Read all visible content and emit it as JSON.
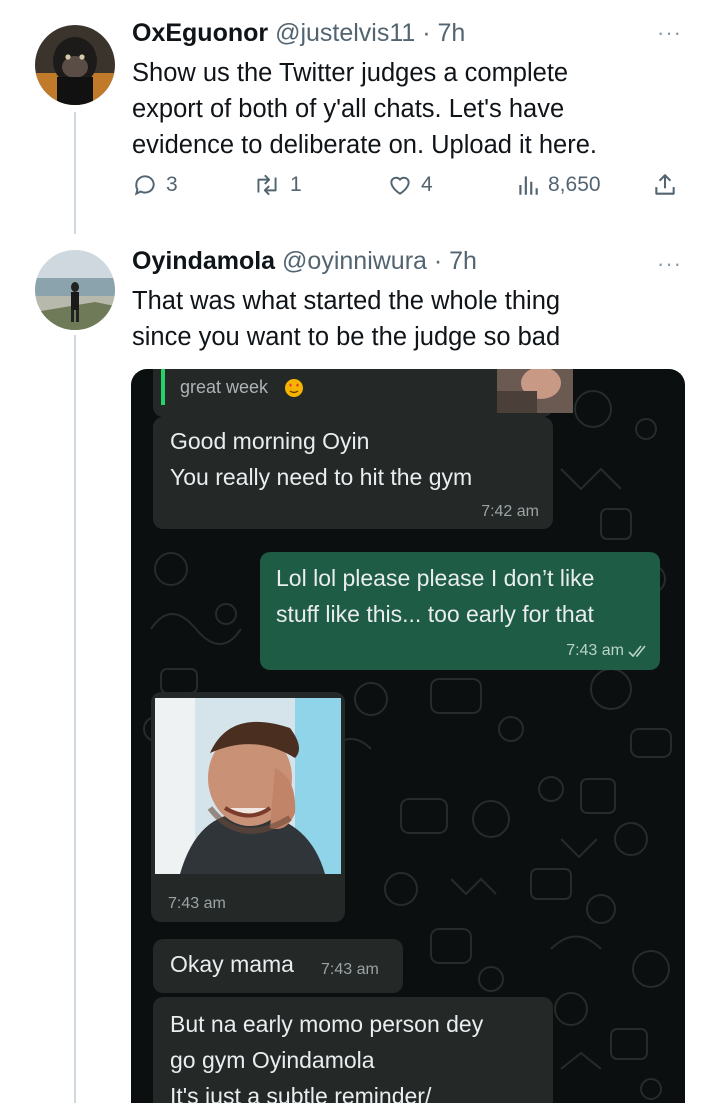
{
  "tweets": [
    {
      "name": "OxEguonor",
      "handle": "@justelvis11",
      "time": "7h",
      "text_lines": [
        "Show us the Twitter judges a complete",
        "export of both of y'all chats. Let's have",
        "evidence to deliberate on. Upload it here."
      ],
      "replies": "3",
      "retweets": "1",
      "likes": "4",
      "views": "8,650",
      "more": "···"
    },
    {
      "name": "Oyindamola",
      "handle": "@oyinniwura",
      "time": "7h",
      "text_lines": [
        "That was what started the whole thing",
        "since you want to be the judge so bad"
      ],
      "more": "···"
    }
  ],
  "chat": {
    "quoted": "great week",
    "messages": [
      {
        "dir": "in",
        "lines": [
          "Good morning Oyin",
          "You really need to hit the gym"
        ],
        "time": "7:42 am"
      },
      {
        "dir": "out",
        "lines": [
          "Lol lol please please I don’t like",
          "stuff like this... too early for that"
        ],
        "time": "7:43 am"
      },
      {
        "dir": "in-image",
        "time": "7:43 am"
      },
      {
        "dir": "in",
        "lines": [
          "Okay mama"
        ],
        "time": "7:43 am"
      },
      {
        "dir": "in",
        "lines": [
          "But na early momo person dey",
          "go gym Oyindamola",
          "It's just a subtle reminder/"
        ]
      }
    ]
  },
  "colors": {
    "thread_line": "#cfd9de",
    "chat_bg": "#0b0f0f",
    "incoming_bubble": "#242826",
    "outgoing_bubble": "#1f5c45",
    "quote_bar": "#25d366"
  }
}
